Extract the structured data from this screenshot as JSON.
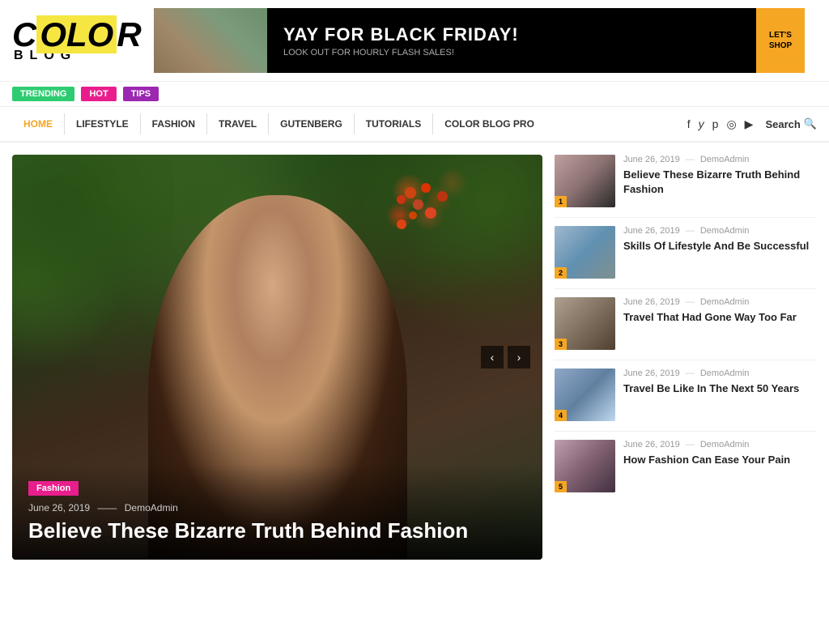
{
  "header": {
    "logo": {
      "color_text": "COLOR",
      "blog_text": "BLOG"
    },
    "banner": {
      "headline": "YAY FOR BLACK FRIDAY!",
      "subtext": "LOOK OUT FOR HOURLY FLASH SALES!",
      "cta": "LET'S SHOP"
    }
  },
  "nav_tags": [
    {
      "label": "TRENDING",
      "color": "#2ecc71",
      "class": "tag-trending"
    },
    {
      "label": "HOT",
      "color": "#e91e8c",
      "class": "tag-hot"
    },
    {
      "label": "TIPS",
      "color": "#9c27b0",
      "class": "tag-tips"
    }
  ],
  "nav": {
    "items": [
      {
        "label": "HOME",
        "active": true
      },
      {
        "label": "LIFESTYLE"
      },
      {
        "label": "FASHION"
      },
      {
        "label": "TRAVEL"
      },
      {
        "label": "GUTENBERG"
      },
      {
        "label": "TUTORIALS"
      },
      {
        "label": "COLOR BLOG PRO"
      }
    ],
    "social": [
      "f",
      "y",
      "p",
      "◎",
      "■"
    ],
    "search_label": "Search"
  },
  "feature": {
    "category": "Fashion",
    "date": "June 26, 2019",
    "author": "DemoAdmin",
    "title": "Believe These Bizarre Truth Behind Fashion",
    "slider_prev": "‹",
    "slider_next": "›"
  },
  "sidebar": {
    "items": [
      {
        "num": "1",
        "date": "June 26, 2019",
        "author": "DemoAdmin",
        "title": "Believe These Bizarre Truth Behind Fashion",
        "thumb_class": "thumb-1"
      },
      {
        "num": "2",
        "date": "June 26, 2019",
        "author": "DemoAdmin",
        "title": "Skills Of Lifestyle And Be Successful",
        "thumb_class": "thumb-2"
      },
      {
        "num": "3",
        "date": "June 26, 2019",
        "author": "DemoAdmin",
        "title": "Travel That Had Gone Way Too Far",
        "thumb_class": "thumb-3"
      },
      {
        "num": "4",
        "date": "June 26, 2019",
        "author": "DemoAdmin",
        "title": "Travel Be Like In The Next 50 Years",
        "thumb_class": "thumb-4"
      },
      {
        "num": "5",
        "date": "June 26, 2019",
        "author": "DemoAdmin",
        "title": "How Fashion Can Ease Your Pain",
        "thumb_class": "thumb-5"
      }
    ]
  }
}
